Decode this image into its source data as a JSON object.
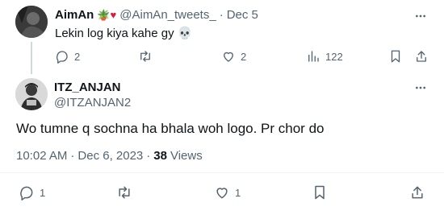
{
  "reply_tweet": {
    "display_name": "AimAn",
    "name_emojis": "🪴 ♥",
    "handle": "@AimAn_tweets_",
    "separator": "·",
    "date": "Dec 5",
    "text": "Lekin log kiya kahe gy 💀",
    "stats": {
      "replies": "2",
      "likes": "2",
      "views": "122"
    }
  },
  "main_tweet": {
    "display_name": "ITZ_ANJAN",
    "handle": "@ITZANJAN2",
    "text": "Wo tumne q sochna ha bhala woh logo. Pr chor do",
    "time": "10:02 AM",
    "dot1": "·",
    "date": "Dec 6, 2023",
    "dot2": "·",
    "views_count": "38",
    "views_label": "Views",
    "stats": {
      "replies": "1",
      "likes": "1"
    }
  },
  "colors": {
    "text": "#0f1419",
    "secondary": "#536471",
    "heart": "#d81e3c",
    "divider": "#eff3f4"
  }
}
